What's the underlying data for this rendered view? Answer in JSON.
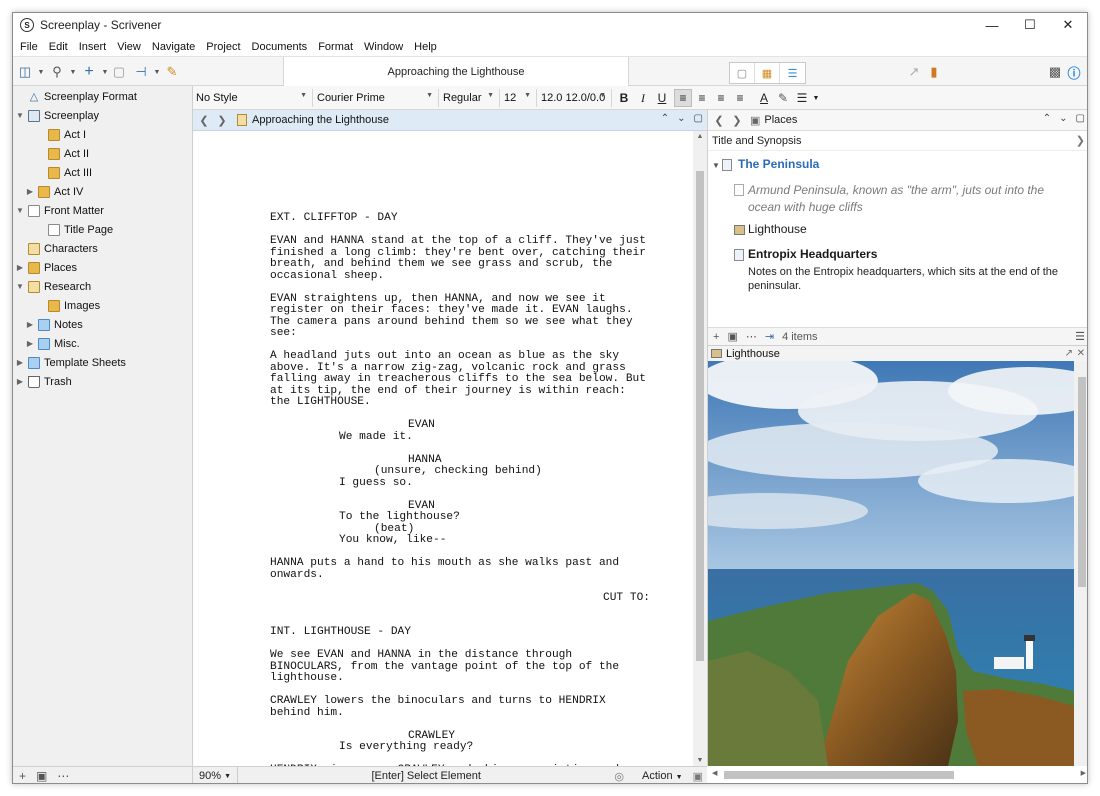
{
  "window": {
    "title": "Screenplay - Scrivener"
  },
  "menu": [
    "File",
    "Edit",
    "Insert",
    "View",
    "Navigate",
    "Project",
    "Documents",
    "Format",
    "Window",
    "Help"
  ],
  "toolbar": {
    "document_title": "Approaching the Lighthouse"
  },
  "binder": [
    {
      "label": "Screenplay Format",
      "indent": 0,
      "icon": "warning-triangle-icon",
      "disclosure": ""
    },
    {
      "label": "Screenplay",
      "indent": 0,
      "icon": "stack-icon",
      "disclosure": "open"
    },
    {
      "label": "Act I",
      "indent": 1,
      "icon": "folder-icon",
      "disclosure": ""
    },
    {
      "label": "Act II",
      "indent": 1,
      "icon": "folder-icon",
      "disclosure": ""
    },
    {
      "label": "Act III",
      "indent": 1,
      "icon": "folder-icon",
      "disclosure": ""
    },
    {
      "label": "Act IV",
      "indent": 1,
      "icon": "folder-icon",
      "disclosure": "closed"
    },
    {
      "label": "Front Matter",
      "indent": 0,
      "icon": "doc-icon",
      "disclosure": "open"
    },
    {
      "label": "Title Page",
      "indent": 1,
      "icon": "doc-icon",
      "disclosure": ""
    },
    {
      "label": "Characters",
      "indent": 0,
      "icon": "characters-icon",
      "disclosure": ""
    },
    {
      "label": "Places",
      "indent": 0,
      "icon": "folder-icon",
      "disclosure": "closed"
    },
    {
      "label": "Research",
      "indent": 0,
      "icon": "research-icon",
      "disclosure": "open"
    },
    {
      "label": "Images",
      "indent": 1,
      "icon": "folder-icon",
      "disclosure": ""
    },
    {
      "label": "Notes",
      "indent": 1,
      "icon": "notes-icon",
      "disclosure": "closed"
    },
    {
      "label": "Misc.",
      "indent": 1,
      "icon": "notes-icon",
      "disclosure": "closed"
    },
    {
      "label": "Template Sheets",
      "indent": 0,
      "icon": "template-icon",
      "disclosure": "closed"
    },
    {
      "label": "Trash",
      "indent": 0,
      "icon": "trash-icon",
      "disclosure": "closed"
    }
  ],
  "formatbar": {
    "style": "No Style",
    "font": "Courier Prime",
    "weight": "Regular",
    "size": "12",
    "spacing": "12.0 12.0/0.0"
  },
  "editor": {
    "header_title": "Approaching the Lighthouse",
    "script": [
      {
        "type": "scene",
        "text": "EXT. CLIFFTOP - DAY"
      },
      {
        "type": "action",
        "text": "EVAN and HANNA stand at the top of a cliff. They've just finished a long climb: they're bent over, catching their breath, and behind them we see grass and scrub, the occasional sheep."
      },
      {
        "type": "action",
        "text": "EVAN straightens up, then HANNA, and now we see it register on their faces: they've made it. EVAN laughs. The camera pans around behind them so we see what they see:"
      },
      {
        "type": "action",
        "text": "A headland juts out into an ocean as blue as the sky above. It's a narrow zig-zag, volcanic rock and grass falling away in treacherous cliffs to the sea below. But at its tip, the end of their journey is within reach: the LIGHTHOUSE."
      },
      {
        "type": "char",
        "text": "EVAN"
      },
      {
        "type": "dial-last",
        "text": "We made it."
      },
      {
        "type": "char",
        "text": "HANNA"
      },
      {
        "type": "paren",
        "text": "(unsure, checking behind)"
      },
      {
        "type": "dial-last",
        "text": "I guess so."
      },
      {
        "type": "char",
        "text": "EVAN"
      },
      {
        "type": "dial",
        "text": "To the lighthouse?"
      },
      {
        "type": "paren",
        "text": "(beat)"
      },
      {
        "type": "dial-last",
        "text": "You know, like--"
      },
      {
        "type": "action",
        "text": "HANNA puts a hand to his mouth as she walks past and onwards."
      },
      {
        "type": "trans",
        "text": "CUT TO:"
      },
      {
        "type": "spacer",
        "text": ""
      },
      {
        "type": "scene",
        "text": "INT. LIGHTHOUSE - DAY"
      },
      {
        "type": "action",
        "text": "We see EVAN and HANNA in the distance through BINOCULARS, from the vantage point of the top of the lighthouse."
      },
      {
        "type": "action",
        "text": "CRAWLEY lowers the binoculars and turns to HENDRIX behind him."
      },
      {
        "type": "char",
        "text": "CRAWLEY"
      },
      {
        "type": "dial-last",
        "text": "Is everything ready?"
      },
      {
        "type": "action",
        "text": "HENDRIX signs yes. CRAWLEY nods his appreciation and raises the binoculars again."
      }
    ],
    "zoom": "90%",
    "footer_center": "[Enter] Select Element",
    "footer_action": "Action"
  },
  "right_pane": {
    "header_title": "Places",
    "column": "Title and Synopsis",
    "parent_title": "The Peninsula",
    "parent_synopsis": "Armund Peninsula, known as \"the arm\", juts out into the ocean with huge cliffs",
    "item2_title": "Lighthouse",
    "item3_title": "Entropix Headquarters",
    "item3_synopsis": "Notes on the Entropix headquarters, which sits at the end of the peninsular.",
    "count": "4 items",
    "quickref_title": "Lighthouse"
  },
  "colors": {
    "accent": "#2a6cb5",
    "header_blue": "#dfeaf7",
    "folder": "#e8b84b"
  }
}
